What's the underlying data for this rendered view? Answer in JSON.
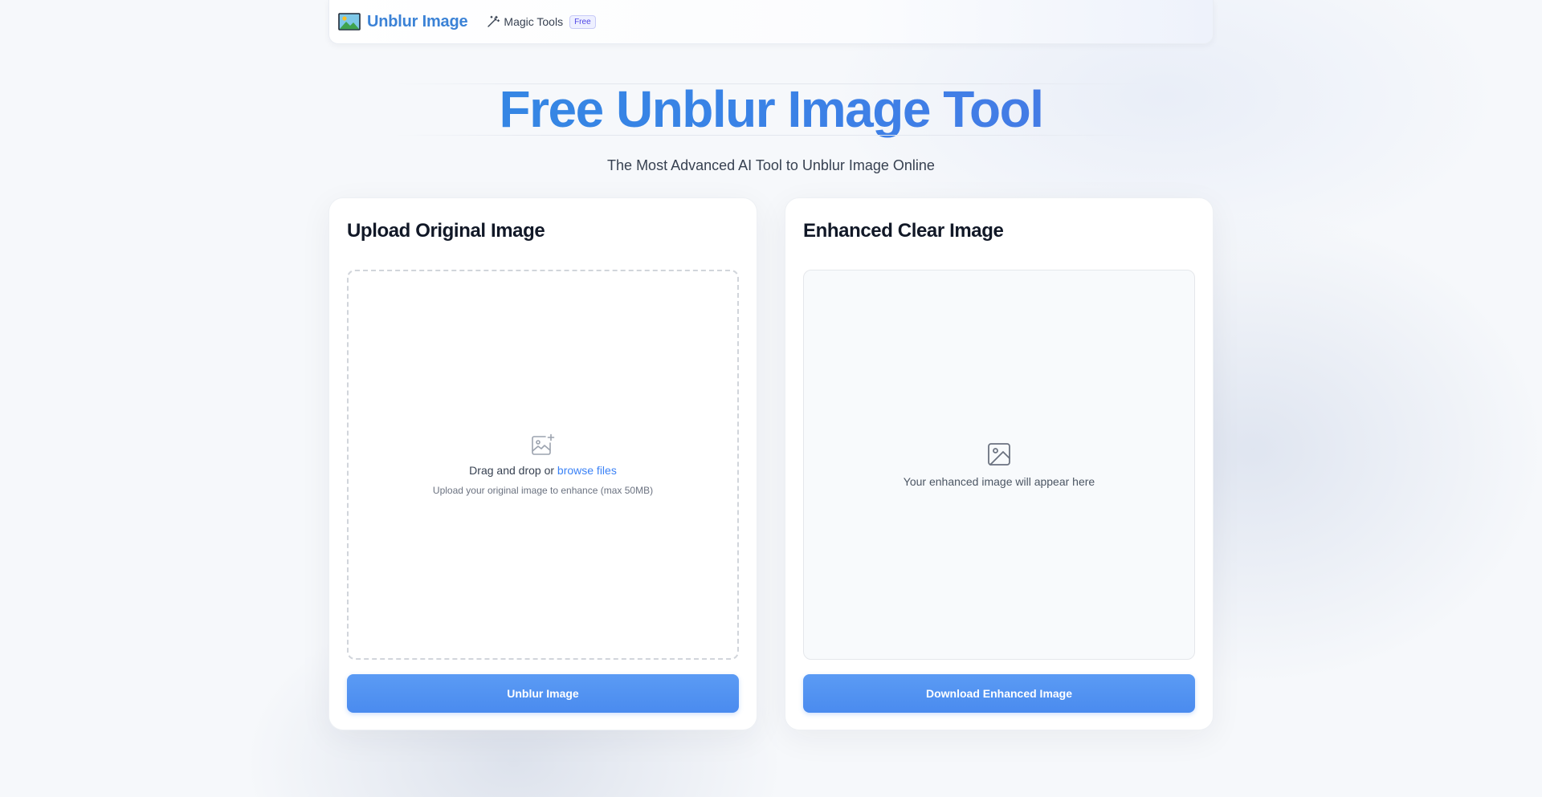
{
  "brand": {
    "name": "Unblur Image",
    "logo_icon": "landscape-image-icon"
  },
  "nav": {
    "magic_tools_label": "Magic Tools",
    "magic_tools_icon": "magic-wand-icon",
    "free_badge": "Free"
  },
  "hero": {
    "title": "Free Unblur Image Tool",
    "subtitle": "The Most Advanced AI Tool to Unblur Image Online"
  },
  "upload_panel": {
    "title": "Upload Original Image",
    "icon": "image-plus-icon",
    "drop_text": "Drag and drop or ",
    "browse_link": "browse files",
    "hint": "Upload your original image to enhance (max 50MB)",
    "button_label": "Unblur Image"
  },
  "result_panel": {
    "title": "Enhanced Clear Image",
    "icon": "image-icon",
    "placeholder": "Your enhanced image will appear here",
    "button_label": "Download Enhanced Image"
  },
  "colors": {
    "brand_blue": "#3b82d6",
    "button_blue": "#4a8bef",
    "link_blue": "#3b82f6",
    "badge_purple": "#4f46e5"
  }
}
